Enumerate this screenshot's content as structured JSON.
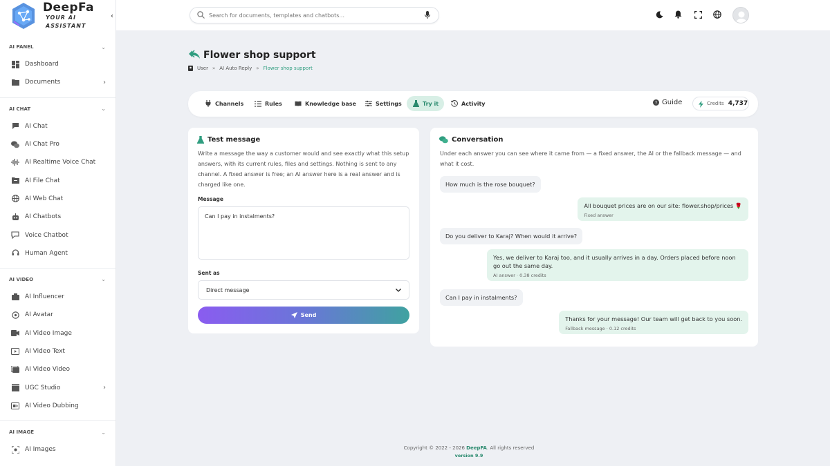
{
  "brand": {
    "name": "DeepFa",
    "tagline": "YOUR AI ASSISTANT"
  },
  "sidebar": {
    "sections": [
      {
        "title": "AI PANEL",
        "items": [
          {
            "label": "Dashboard",
            "icon": "dashboard-icon",
            "has_arrow": false
          },
          {
            "label": "Documents",
            "icon": "folder-icon",
            "has_arrow": true
          }
        ]
      },
      {
        "title": "AI CHAT",
        "items": [
          {
            "label": "AI Chat",
            "icon": "chat-icon",
            "has_arrow": false
          },
          {
            "label": "AI Chat Pro",
            "icon": "chats-icon",
            "has_arrow": false
          },
          {
            "label": "AI Realtime Voice Chat",
            "icon": "waveform-icon",
            "has_arrow": false
          },
          {
            "label": "AI File Chat",
            "icon": "file-icon",
            "has_arrow": false
          },
          {
            "label": "AI Web Chat",
            "icon": "globe-icon",
            "has_arrow": false
          },
          {
            "label": "AI Chatbots",
            "icon": "robot-icon",
            "has_arrow": false
          },
          {
            "label": "Voice Chatbot",
            "icon": "voice-chat-icon",
            "has_arrow": false
          },
          {
            "label": "Human Agent",
            "icon": "headset-icon",
            "has_arrow": false
          }
        ]
      },
      {
        "title": "AI VIDEO",
        "items": [
          {
            "label": "AI Influencer",
            "icon": "influencer-icon",
            "has_arrow": false
          },
          {
            "label": "AI Avatar",
            "icon": "avatar-icon",
            "has_arrow": false
          },
          {
            "label": "AI Video Image",
            "icon": "video-image-icon",
            "has_arrow": false
          },
          {
            "label": "AI Video Text",
            "icon": "video-text-icon",
            "has_arrow": false
          },
          {
            "label": "AI Video Video",
            "icon": "video-video-icon",
            "has_arrow": false
          },
          {
            "label": "UGC Studio",
            "icon": "clapper-icon",
            "has_arrow": true
          },
          {
            "label": "AI Video Dubbing",
            "icon": "dubbing-icon",
            "has_arrow": false
          }
        ]
      },
      {
        "title": "AI IMAGE",
        "items": [
          {
            "label": "AI Images",
            "icon": "image-scan-icon",
            "has_arrow": false
          }
        ]
      }
    ]
  },
  "topbar": {
    "search_placeholder": "Search for documents, templates and chatbots..."
  },
  "page": {
    "title": "Flower shop support",
    "breadcrumb": [
      "User",
      "AI Auto Reply",
      "Flower shop support"
    ]
  },
  "tabs": [
    {
      "label": "Channels",
      "icon": "plug-icon",
      "active": false
    },
    {
      "label": "Rules",
      "icon": "list-icon",
      "active": false
    },
    {
      "label": "Knowledge base",
      "icon": "book-icon",
      "active": false
    },
    {
      "label": "Settings",
      "icon": "sliders-icon",
      "active": false
    },
    {
      "label": "Try it",
      "icon": "flask-icon",
      "active": true
    },
    {
      "label": "Activity",
      "icon": "history-icon",
      "active": false
    }
  ],
  "guide_label": "Guide",
  "credits": {
    "label": "Credits",
    "value": "4,737"
  },
  "test_panel": {
    "title": "Test message",
    "description": "Write a message the way a customer would and see exactly what this setup answers, with its current rules, files and settings. Nothing is sent to any channel. A fixed answer is free; an AI answer here is a real answer and is charged like one.",
    "message_label": "Message",
    "message_value": "Can I pay in instalments?",
    "sent_as_label": "Sent as",
    "sent_as_value": "Direct message",
    "send_label": "Send"
  },
  "conversation": {
    "title": "Conversation",
    "description": "Under each answer you can see where it came from — a fixed answer, the AI or the fallback message — and what it cost.",
    "messages": [
      {
        "role": "user",
        "text": "How much is the rose bouquet?"
      },
      {
        "role": "bot",
        "text": "All bouquet prices are on our site: flower.shop/prices 🌹",
        "meta": "Fixed answer"
      },
      {
        "role": "user",
        "text": "Do you deliver to Karaj? When would it arrive?"
      },
      {
        "role": "bot",
        "text": "Yes, we deliver to Karaj too, and it usually arrives in a day. Orders placed before noon go out the same day.",
        "meta": "AI answer · 0.38 credits"
      },
      {
        "role": "user",
        "text": "Can I pay in instalments?"
      },
      {
        "role": "bot",
        "text": "Thanks for your message! Our team will get back to you soon.",
        "meta": "Fallback message · 0.12 credits"
      }
    ]
  },
  "footer": {
    "copyright_prefix": "Copyright © 2022 - 2026 ",
    "brand": "DeepFA",
    "copyright_suffix": ". All rights reserved",
    "version": "version 9.9"
  },
  "colors": {
    "accent": "#2f9d7f",
    "active_tab_bg": "#d8efe6",
    "bot_bubble": "#e3f4ec",
    "user_bubble": "#f0f2f5"
  }
}
